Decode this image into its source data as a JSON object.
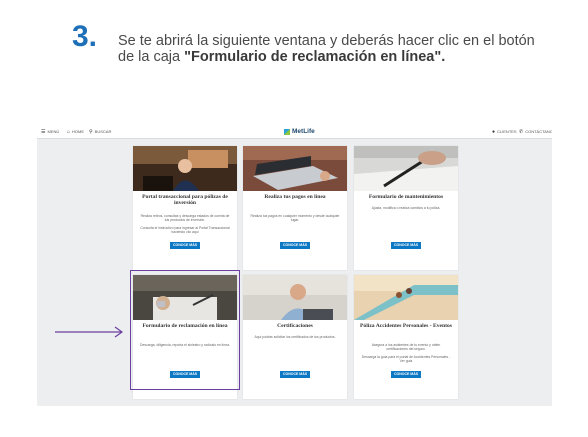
{
  "step": {
    "number": "3.",
    "text_plain": "Se te abrirá la siguiente ventana y deberás hacer clic en el botón de la caja ",
    "text_bold": "\"Formulario de reclamación en línea\"."
  },
  "topbar": {
    "menu_label": "MENÚ",
    "home_label": "HOME",
    "search_label": "BUSCAR",
    "brand": "MetLife",
    "clients_label": "CLIENTES",
    "contact_label": "CONTÁCTANOS"
  },
  "cards": [
    {
      "title": "Portal transaccional para pólizas de inversión",
      "desc": "Realiza retiros, consultas y descarga estados de cuenta de tus productos de inversión.",
      "desc2": "Consulta el instructivo para ingresar al Portal Transaccional haciendo clic aquí",
      "button": "CONOCE MÁS"
    },
    {
      "title": "Realiza tus pagos en línea",
      "desc": "Realiza tus pagos en cualquier momento y desde cualquier lugar.",
      "desc2": "",
      "button": "CONOCE MÁS"
    },
    {
      "title": "Formulario de mantenimientos",
      "desc": "Ajusta, modifica o realiza cambios a tu póliza.",
      "desc2": "",
      "button": "CONOCE MÁS"
    },
    {
      "title": "Formulario de reclamación en línea",
      "desc": "Descarga, diligencia, reporta el siniestro y radícalo en línea.",
      "desc2": "",
      "button": "CONOCE MÁS"
    },
    {
      "title": "Certificaciones",
      "desc": "Aquí podrás solicitar los certificados de tus productos.",
      "desc2": "",
      "button": "CONOCE MÁS"
    },
    {
      "title": "Póliza Accidentes Personales - Eventos",
      "desc": "Asegura a los asistentes de tu evento y obtén certificaciones del seguro.",
      "desc2": "Descarga la guía para el portal de Accidentes Personales - Ver guía",
      "button": "CONOCE MÁS"
    }
  ],
  "colors": {
    "accent": "#1d6fb8",
    "button": "#0d78c4",
    "highlight": "#6b3fa0"
  }
}
